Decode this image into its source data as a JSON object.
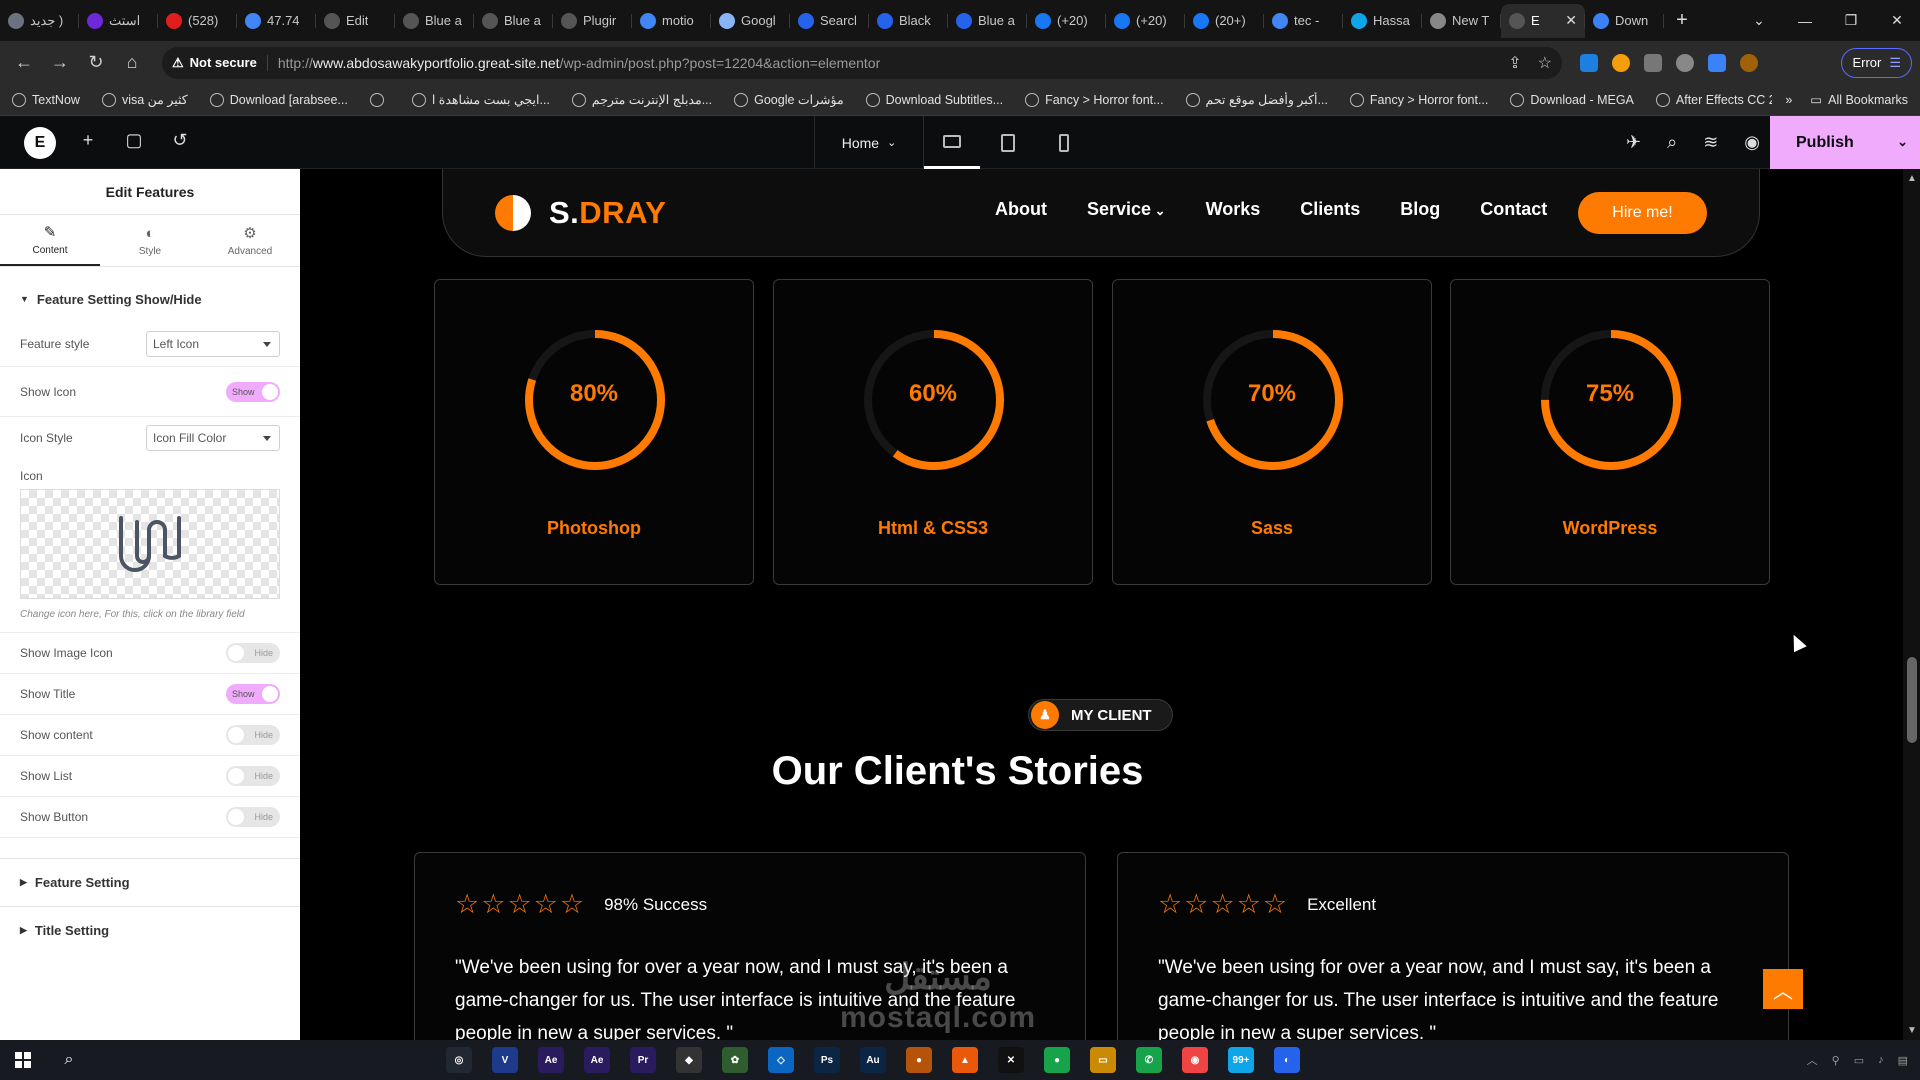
{
  "browser": {
    "tabs": [
      {
        "title": "جديد )",
        "color": "#6b7280"
      },
      {
        "title": "استث",
        "color": "#6d28d9"
      },
      {
        "title": "(528)",
        "color": "#e11d1d"
      },
      {
        "title": "47.74",
        "color": "#4285f4"
      },
      {
        "title": "Edit",
        "color": "#555555"
      },
      {
        "title": "Blue a",
        "color": "#555555"
      },
      {
        "title": "Blue a",
        "color": "#555555"
      },
      {
        "title": "Plugir",
        "color": "#555555"
      },
      {
        "title": "motio",
        "color": "#4285f4"
      },
      {
        "title": "Googl",
        "color": "#8ab4f8"
      },
      {
        "title": "Searcl",
        "color": "#2563eb"
      },
      {
        "title": "Black",
        "color": "#2563eb"
      },
      {
        "title": "Blue a",
        "color": "#2563eb"
      },
      {
        "title": "(+20)",
        "color": "#1877f2"
      },
      {
        "title": "(+20)",
        "color": "#1877f2"
      },
      {
        "title": "(20+)",
        "color": "#1877f2"
      },
      {
        "title": "tec -",
        "color": "#4285f4"
      },
      {
        "title": "Hassa",
        "color": "#0ea5e9"
      },
      {
        "title": "New T",
        "color": "#888888"
      },
      {
        "title": "E",
        "color": "#555555",
        "active": true
      },
      {
        "title": "Down",
        "color": "#3b82f6"
      }
    ],
    "not_secure_label": "Not secure",
    "url_domain": "www.abdosawakyportfolio.great-site.net",
    "url_path": "/wp-admin/post.php?post=12204&action=elementor",
    "url_scheme": "http://",
    "error_label": "Error",
    "bookmarks": [
      "TextNow",
      "visa كثير من",
      "Download [arabsee...",
      "",
      "ايجي بست مشاهدة ا...",
      "مدبلج الإنترنت مترجم...",
      "Google مؤشرات",
      "Download Subtitles...",
      "Fancy > Horror font...",
      "أكبر وأفضل موقع تحم...",
      "Fancy > Horror font...",
      "Download - MEGA",
      "After Effects CC 201..."
    ],
    "all_bookmarks_label": "All Bookmarks"
  },
  "elementor": {
    "logo": "E",
    "page_selector": "Home",
    "publish_label": "Publish"
  },
  "panel": {
    "title": "Edit Features",
    "tabs": [
      {
        "label": "Content",
        "icon": "pencil-icon"
      },
      {
        "label": "Style",
        "icon": "contrast-icon"
      },
      {
        "label": "Advanced",
        "icon": "gear-icon"
      }
    ],
    "section_open": "Feature Setting Show/Hide",
    "feature_style_label": "Feature style",
    "feature_style_value": "Left Icon",
    "show_icon_label": "Show Icon",
    "show_icon_state": "Show",
    "icon_style_label": "Icon Style",
    "icon_style_value": "Icon Fill Color",
    "icon_label": "Icon",
    "icon_hint": "Change icon here, For this, click on the library field",
    "toggles": [
      {
        "label": "Show Image Icon",
        "state": "Hide",
        "on": false
      },
      {
        "label": "Show Title",
        "state": "Show",
        "on": true
      },
      {
        "label": "Show content",
        "state": "Hide",
        "on": false
      },
      {
        "label": "Show List",
        "state": "Hide",
        "on": false
      },
      {
        "label": "Show Button",
        "state": "Hide",
        "on": false
      }
    ],
    "section_feature": "Feature Setting",
    "section_title": "Title Setting"
  },
  "site": {
    "brand_prefix": "S.",
    "brand_accent": "DRAY",
    "menu": [
      "About",
      "Service",
      "Works",
      "Clients",
      "Blog",
      "Contact"
    ],
    "hire_label": "Hire me!",
    "accent_color": "#ff7a00",
    "skills": [
      {
        "name": "Photoshop",
        "label": "80%",
        "percent": 80
      },
      {
        "name": "Html & CSS3",
        "label": "60%",
        "percent": 60
      },
      {
        "name": "Sass",
        "label": "70%",
        "percent": 70
      },
      {
        "name": "WordPress",
        "label": "75%",
        "percent": 75
      }
    ],
    "client_badge": "MY CLIENT",
    "stories_title": "Our Client's Stories",
    "testimonials": [
      {
        "label": "98% Success",
        "stars": 5,
        "quote": "\"We've been using for over a year now, and I must say, it's been a game-changer for us. The user interface is intuitive and the feature people in new a super services. \""
      },
      {
        "label": "Excellent",
        "stars": 5,
        "quote": "\"We've been using for over a year now, and I must say, it's been a game-changer for us. The user interface is intuitive and the feature people in new a super services. \""
      }
    ],
    "watermark_arabic": "مستقل",
    "watermark_latin": "mostaql.com"
  },
  "taskbar": {
    "apps": [
      {
        "label": "◎",
        "color": "#222831"
      },
      {
        "label": "V",
        "color": "#1e3a8a"
      },
      {
        "label": "Ae",
        "color": "#2a1b5e"
      },
      {
        "label": "Ae",
        "color": "#2a1b5e"
      },
      {
        "label": "Pr",
        "color": "#2a1b5e"
      },
      {
        "label": "◆",
        "color": "#333333"
      },
      {
        "label": "✿",
        "color": "#2f5d2f"
      },
      {
        "label": "◇",
        "color": "#0a66c2"
      },
      {
        "label": "Ps",
        "color": "#0b2545"
      },
      {
        "label": "Au",
        "color": "#0b2545"
      },
      {
        "label": "●",
        "color": "#b45309"
      },
      {
        "label": "▲",
        "color": "#ea580c"
      },
      {
        "label": "✕",
        "color": "#111111"
      },
      {
        "label": "●",
        "color": "#16a34a"
      },
      {
        "label": "▭",
        "color": "#ca8a04"
      },
      {
        "label": "✆",
        "color": "#16a34a"
      },
      {
        "label": "◉",
        "color": "#ef4444"
      },
      {
        "label": "99+",
        "color": "#0ea5e9"
      },
      {
        "label": "◐",
        "color": "#2563eb"
      }
    ]
  }
}
